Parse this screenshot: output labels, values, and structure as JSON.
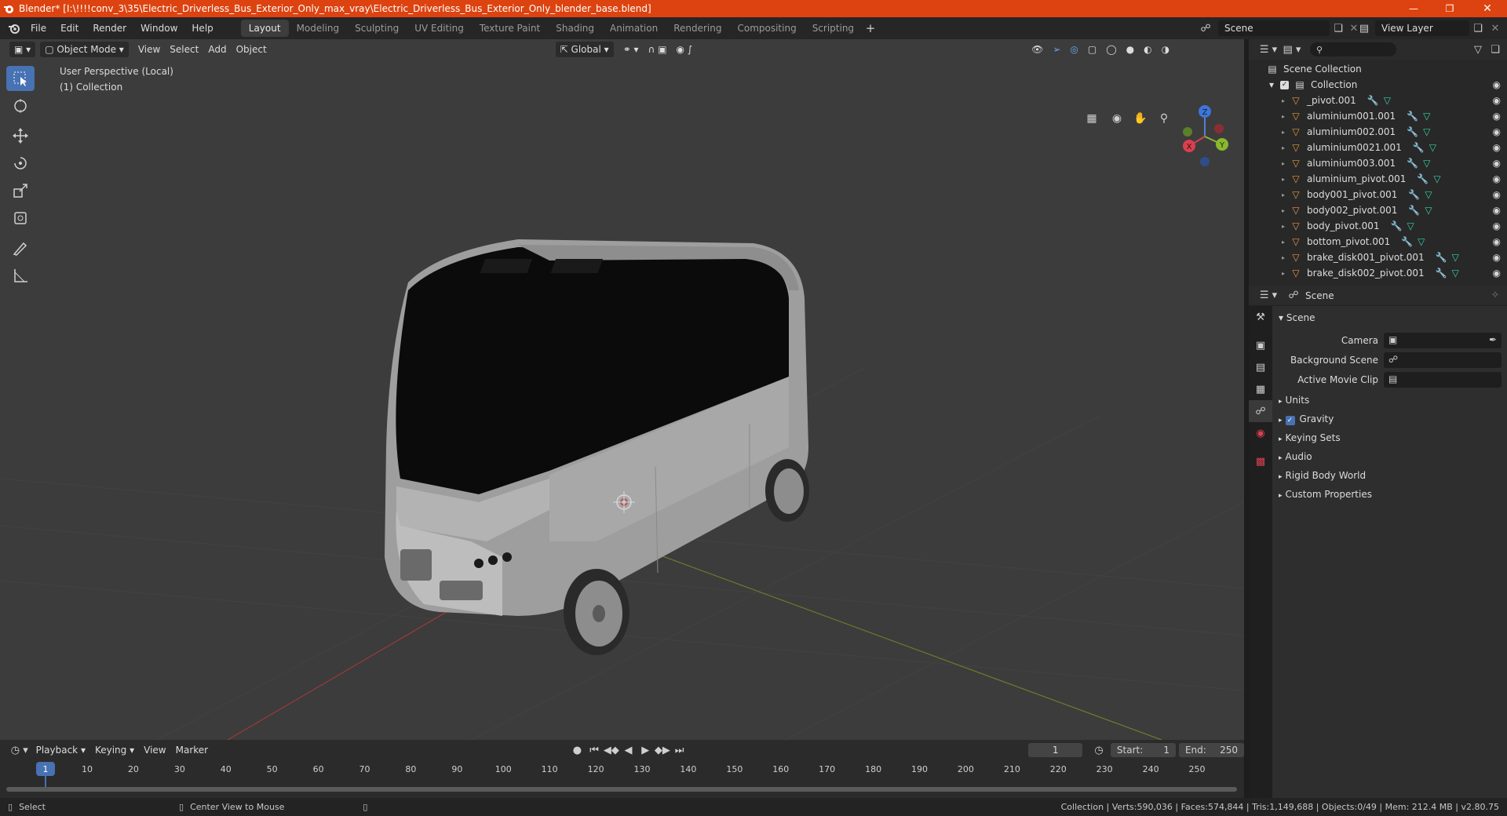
{
  "window": {
    "title": "Blender* [I:\\!!!!conv_3\\35\\Electric_Driverless_Bus_Exterior_Only_max_vray\\Electric_Driverless_Bus_Exterior_Only_blender_base.blend]",
    "minimize_icon": "minimize-icon",
    "maximize_icon": "maximize-icon",
    "close_icon": "close-icon"
  },
  "menu": [
    "File",
    "Edit",
    "Render",
    "Window",
    "Help"
  ],
  "workspaces": [
    {
      "label": "Layout",
      "active": true
    },
    {
      "label": "Modeling",
      "active": false
    },
    {
      "label": "Sculpting",
      "active": false
    },
    {
      "label": "UV Editing",
      "active": false
    },
    {
      "label": "Texture Paint",
      "active": false
    },
    {
      "label": "Shading",
      "active": false
    },
    {
      "label": "Animation",
      "active": false
    },
    {
      "label": "Rendering",
      "active": false
    },
    {
      "label": "Compositing",
      "active": false
    },
    {
      "label": "Scripting",
      "active": false
    }
  ],
  "scene_field": "Scene",
  "view_layer_field": "View Layer",
  "viewport": {
    "mode": "Object Mode",
    "menus": [
      "View",
      "Select",
      "Add",
      "Object"
    ],
    "orientation": "Global",
    "overlay_title": "User Perspective (Local)",
    "overlay_collection": "(1) Collection",
    "gizmo": {
      "x": "X",
      "y": "Y",
      "z": "Z"
    }
  },
  "outliner": {
    "root": "Scene Collection",
    "collection": "Collection",
    "items": [
      "_pivot.001",
      "aluminium001.001",
      "aluminium002.001",
      "aluminium0021.001",
      "aluminium003.001",
      "aluminium_pivot.001",
      "body001_pivot.001",
      "body002_pivot.001",
      "body_pivot.001",
      "bottom_pivot.001",
      "brake_disk001_pivot.001",
      "brake_disk002_pivot.001"
    ]
  },
  "properties": {
    "header": "Scene",
    "section": "Scene",
    "fields": [
      {
        "label": "Camera"
      },
      {
        "label": "Background Scene"
      },
      {
        "label": "Active Movie Clip"
      }
    ],
    "panels": [
      {
        "label": "Units",
        "checkbox": false
      },
      {
        "label": "Gravity",
        "checkbox": true
      },
      {
        "label": "Keying Sets",
        "checkbox": false
      },
      {
        "label": "Audio",
        "checkbox": false
      },
      {
        "label": "Rigid Body World",
        "checkbox": false
      },
      {
        "label": "Custom Properties",
        "checkbox": false
      }
    ]
  },
  "timeline": {
    "menus": [
      "Playback",
      "Keying",
      "View",
      "Marker"
    ],
    "current_frame": "1",
    "start_label": "Start:",
    "start": "1",
    "end_label": "End:",
    "end": "250",
    "ticks": [
      "1",
      "10",
      "20",
      "30",
      "40",
      "50",
      "60",
      "70",
      "80",
      "90",
      "100",
      "110",
      "120",
      "130",
      "140",
      "150",
      "160",
      "170",
      "180",
      "190",
      "200",
      "210",
      "220",
      "230",
      "240",
      "250"
    ]
  },
  "status": {
    "select": "Select",
    "center_view": "Center View to Mouse",
    "stats": "Collection | Verts:590,036 | Faces:574,844 | Tris:1,149,688 | Objects:0/49 | Mem: 212.4 MB | v2.80.75"
  }
}
